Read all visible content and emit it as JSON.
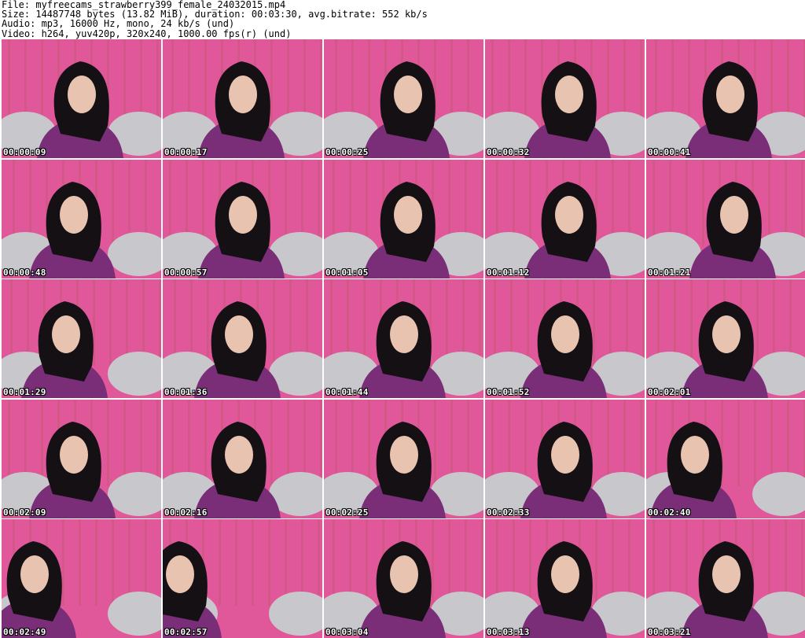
{
  "header": {
    "file": "File: myfreecams_strawberry399_female_24032015.mp4",
    "size": "Size: 14487748 bytes (13.82 MiB), duration: 00:03:30, avg.bitrate: 552 kb/s",
    "audio": "Audio: mp3, 16000 Hz, mono, 24 kb/s (und)",
    "video": "Video: h264, yuv420p, 320x240, 1000.00 fps(r) (und)"
  },
  "thumbnails": [
    {
      "timestamp": "00:00:09"
    },
    {
      "timestamp": "00:00:17"
    },
    {
      "timestamp": "00:00:25"
    },
    {
      "timestamp": "00:00:32"
    },
    {
      "timestamp": "00:00:41"
    },
    {
      "timestamp": "00:00:48"
    },
    {
      "timestamp": "00:00:57"
    },
    {
      "timestamp": "00:01:05"
    },
    {
      "timestamp": "00:01:12"
    },
    {
      "timestamp": "00:01:21"
    },
    {
      "timestamp": "00:01:29"
    },
    {
      "timestamp": "00:01:36"
    },
    {
      "timestamp": "00:01:44"
    },
    {
      "timestamp": "00:01:52"
    },
    {
      "timestamp": "00:02:01"
    },
    {
      "timestamp": "00:02:09"
    },
    {
      "timestamp": "00:02:16"
    },
    {
      "timestamp": "00:02:25"
    },
    {
      "timestamp": "00:02:33"
    },
    {
      "timestamp": "00:02:40"
    },
    {
      "timestamp": "00:02:49"
    },
    {
      "timestamp": "00:02:57"
    },
    {
      "timestamp": "00:03:04"
    },
    {
      "timestamp": "00:03:13"
    },
    {
      "timestamp": "00:03:21"
    }
  ],
  "colors": {
    "backdrop": "#e0589a",
    "stripe": "#c85a7a",
    "pillow": "#c8c8cc",
    "sweater": "#7a2e78",
    "hair": "#141014",
    "skin": "#e8c4b0"
  }
}
